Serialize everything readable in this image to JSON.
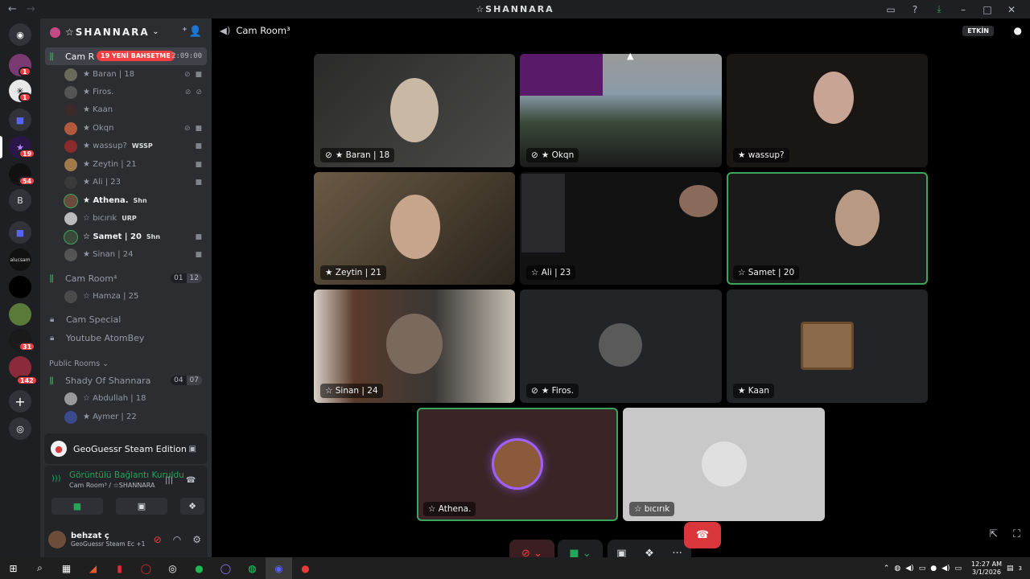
{
  "window": {
    "title": "☆SHANNARA"
  },
  "server": {
    "name": "☆SHANNARA"
  },
  "rail_badges": [
    "1",
    "1",
    "19",
    "54",
    "31",
    "142"
  ],
  "rail_letter": "B",
  "channels": {
    "active": {
      "name": "Cam R",
      "live_badge": "19 YENİ BAHSETME",
      "timer": "2:09:00"
    },
    "members": [
      {
        "name": "★ Baran | 18",
        "tag": ""
      },
      {
        "name": "★ Firos.",
        "tag": ""
      },
      {
        "name": "★ Kaan",
        "tag": ""
      },
      {
        "name": "★ Okqn",
        "tag": ""
      },
      {
        "name": "★ wassup?",
        "tag": "WSSP"
      },
      {
        "name": "★ Zeytin | 21",
        "tag": ""
      },
      {
        "name": "★ Ali | 23",
        "tag": ""
      },
      {
        "name": "★ Athena.",
        "tag": "Shn"
      },
      {
        "name": "☆ bıcırık",
        "tag": "URP"
      },
      {
        "name": "☆ Samet | 20",
        "tag": "Shn"
      },
      {
        "name": "★ Sinan | 24",
        "tag": ""
      }
    ],
    "room4": {
      "name": "Cam Room⁴",
      "count_a": "01",
      "count_b": "12"
    },
    "room4_member": "☆ Hamza | 25",
    "cam_special": "Cam Special",
    "youtube": "Youtube AtomBey",
    "category": "Public Rooms",
    "shady": {
      "name": "Shady Of Shannara",
      "count_a": "04",
      "count_b": "07"
    },
    "shady_members": [
      "☆ Abdullah | 18",
      "★ Aymer | 22"
    ]
  },
  "activity": {
    "game": "GeoGuessr Steam Edition"
  },
  "connection": {
    "status": "Görüntülü Bağlantı Kuruldu",
    "sub": "Cam Room³ / ☆SHANNARA"
  },
  "user": {
    "name": "behzat ç",
    "status": "GeoGuessr Steam Ec +1"
  },
  "main": {
    "channel": "Cam Room³",
    "activity_btn": "ETKİN"
  },
  "tiles": [
    {
      "label": "★ Baran | 18"
    },
    {
      "label": "★ Okqn"
    },
    {
      "label": "★ wassup?"
    },
    {
      "label": "★ Zeytin | 21"
    },
    {
      "label": "☆ Ali | 23"
    },
    {
      "label": "☆ Samet | 20"
    },
    {
      "label": "☆ Sinan | 24"
    },
    {
      "label": "★ Firos."
    },
    {
      "label": "★ Kaan"
    },
    {
      "label": "☆ Athena."
    },
    {
      "label": "☆ bıcırık"
    }
  ],
  "clock": {
    "time": "12:27 AM",
    "date": "3/1/2026"
  },
  "notif_count": "3"
}
